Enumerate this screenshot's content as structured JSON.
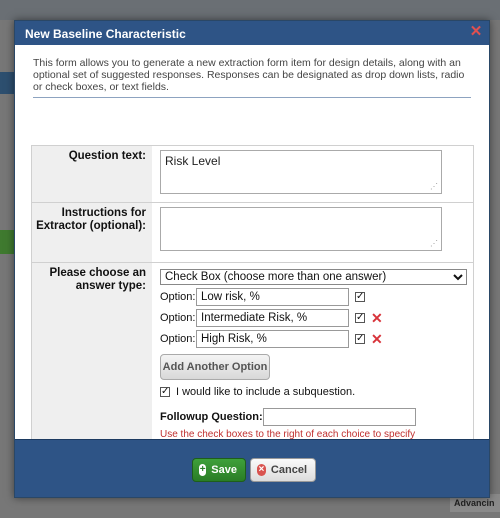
{
  "dialog": {
    "title": "New Baseline Characteristic",
    "intro": "This form allows you to generate a new extraction form item for design details, along with an optional set of suggested responses. Responses can be designated as drop down lists, radio or check boxes, or text fields."
  },
  "form": {
    "question_label": "Question text:",
    "question_value": "Risk Level",
    "instructions_label": "Instructions for Extractor (optional):",
    "instructions_value": "",
    "answer_type_label": "Please choose an answer type:",
    "answer_type_selected": "Check Box (choose more than one answer)",
    "option_label": "Option:",
    "options": [
      {
        "value": "Low risk, %",
        "checked": true,
        "deletable": false
      },
      {
        "value": "Intermediate Risk, %",
        "checked": true,
        "deletable": true
      },
      {
        "value": "High Risk, %",
        "checked": true,
        "deletable": true
      }
    ],
    "add_option_label": "Add Another Option",
    "subquestion_label": "I would like to include a subquestion.",
    "followup_label": "Followup Question:",
    "followup_value": "",
    "note": "Use the check boxes to the right of each choice to specify whether or not to associate the subquestion with that choice."
  },
  "footer": {
    "save_label": "Save",
    "cancel_label": "Cancel"
  },
  "background": {
    "bottom_right_text": "Advancin"
  },
  "colors": {
    "titlebar": "#2e5486",
    "save": "#3fa03a",
    "danger": "#d8333a"
  }
}
